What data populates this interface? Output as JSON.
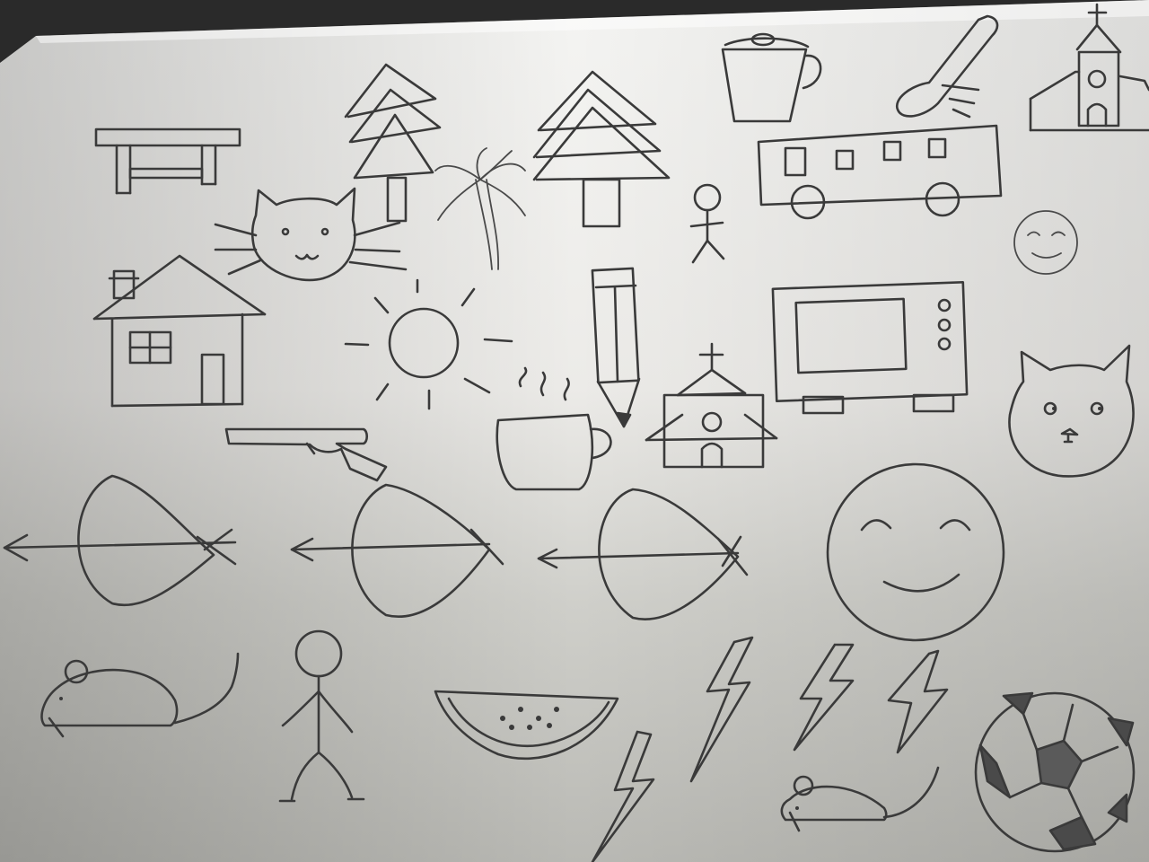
{
  "image": {
    "description_items": [
      "torii",
      "pine-tree",
      "pine-tree",
      "palm-tree",
      "cat-face",
      "cup",
      "spoon",
      "church",
      "bus",
      "stick-figure",
      "smiley",
      "house",
      "sun",
      "pencil",
      "coffee-cup",
      "microwave",
      "church",
      "cat-face",
      "gun",
      "bow-and-arrow",
      "bow-and-arrow",
      "bow-and-arrow",
      "smiley",
      "mouse",
      "stick-figure",
      "watermelon",
      "lightning",
      "lightning",
      "lightning",
      "lightning",
      "mouse",
      "soccer-ball"
    ],
    "colors": {
      "paper_light": "#f4f4f2",
      "paper_shadow": "#b9b9b4",
      "pencil": "#3a3a3a",
      "background": "#2a2a2a"
    }
  }
}
